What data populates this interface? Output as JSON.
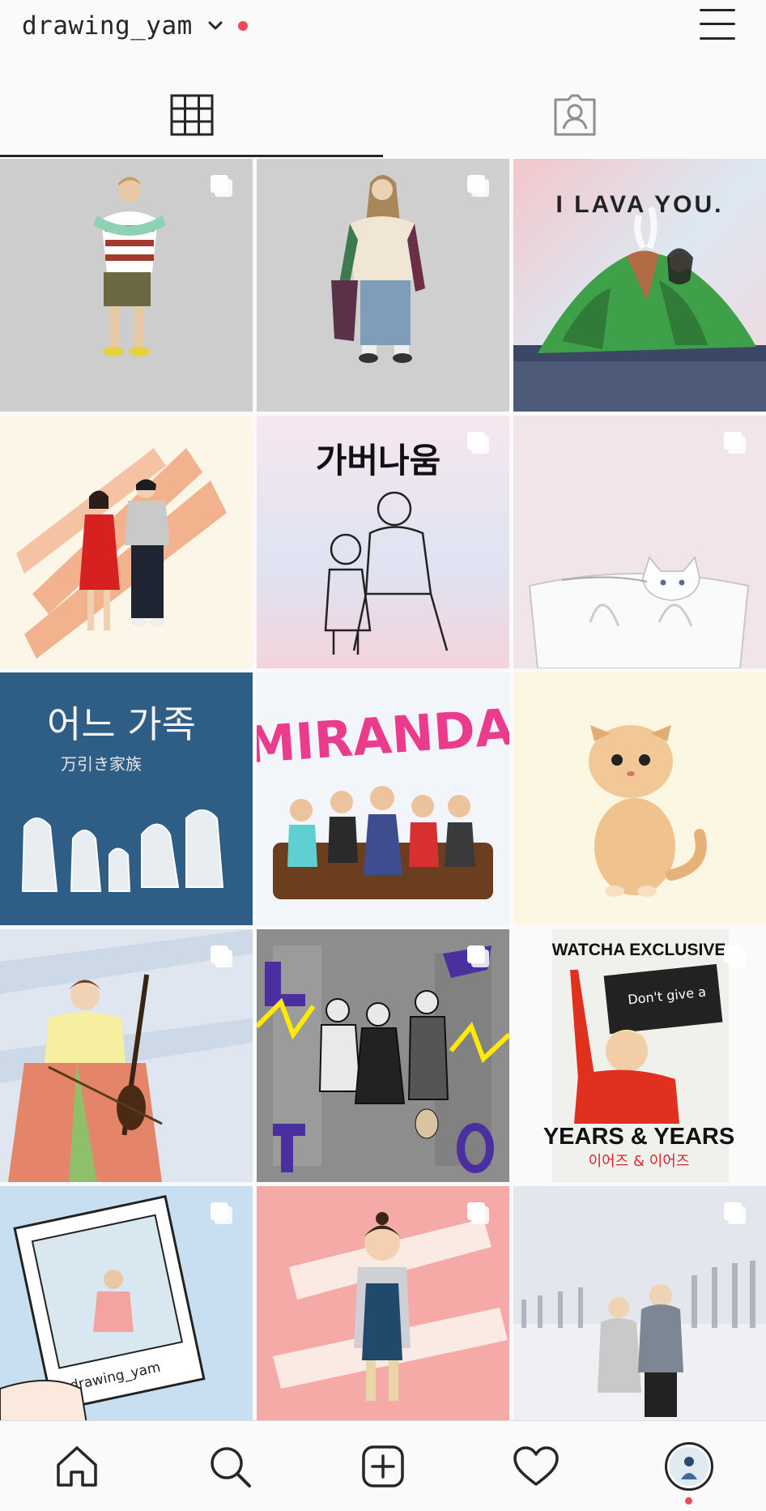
{
  "header": {
    "username": "drawing_yam",
    "has_notification": true
  },
  "tabs": [
    {
      "name": "grid",
      "icon": "grid-icon",
      "active": true
    },
    {
      "name": "tagged",
      "icon": "tagged-person-icon",
      "active": false
    }
  ],
  "posts": [
    {
      "caption": "",
      "multi": true
    },
    {
      "caption": "",
      "multi": true
    },
    {
      "caption": "I LAVA YOU.",
      "multi": false
    },
    {
      "caption": "",
      "multi": false
    },
    {
      "caption": "가버나움",
      "multi": true
    },
    {
      "caption": "",
      "multi": true
    },
    {
      "caption": "어느 가족",
      "subcaption": "万引き家族",
      "multi": false
    },
    {
      "caption": "MIRANDA",
      "multi": false
    },
    {
      "caption": "",
      "multi": false
    },
    {
      "caption": "",
      "multi": true
    },
    {
      "caption": "",
      "multi": true
    },
    {
      "caption": "WATCHA EXCLUSIVE",
      "sign": "Don't give a",
      "years": "YEARS & YEARS",
      "subtitle": "이어즈 & 이어즈",
      "multi": true
    },
    {
      "caption": "",
      "watermark": "@drawing_yam",
      "multi": true
    },
    {
      "caption": "",
      "multi": true
    },
    {
      "caption": "",
      "multi": true
    }
  ],
  "bottom_nav": [
    {
      "name": "home",
      "icon": "home-icon"
    },
    {
      "name": "search",
      "icon": "search-icon"
    },
    {
      "name": "new-post",
      "icon": "plus-square-icon"
    },
    {
      "name": "activity",
      "icon": "heart-icon"
    },
    {
      "name": "profile",
      "icon": "avatar"
    }
  ],
  "colors": {
    "accent_red": "#ed4956",
    "text": "#262626",
    "background": "#fafafa"
  }
}
